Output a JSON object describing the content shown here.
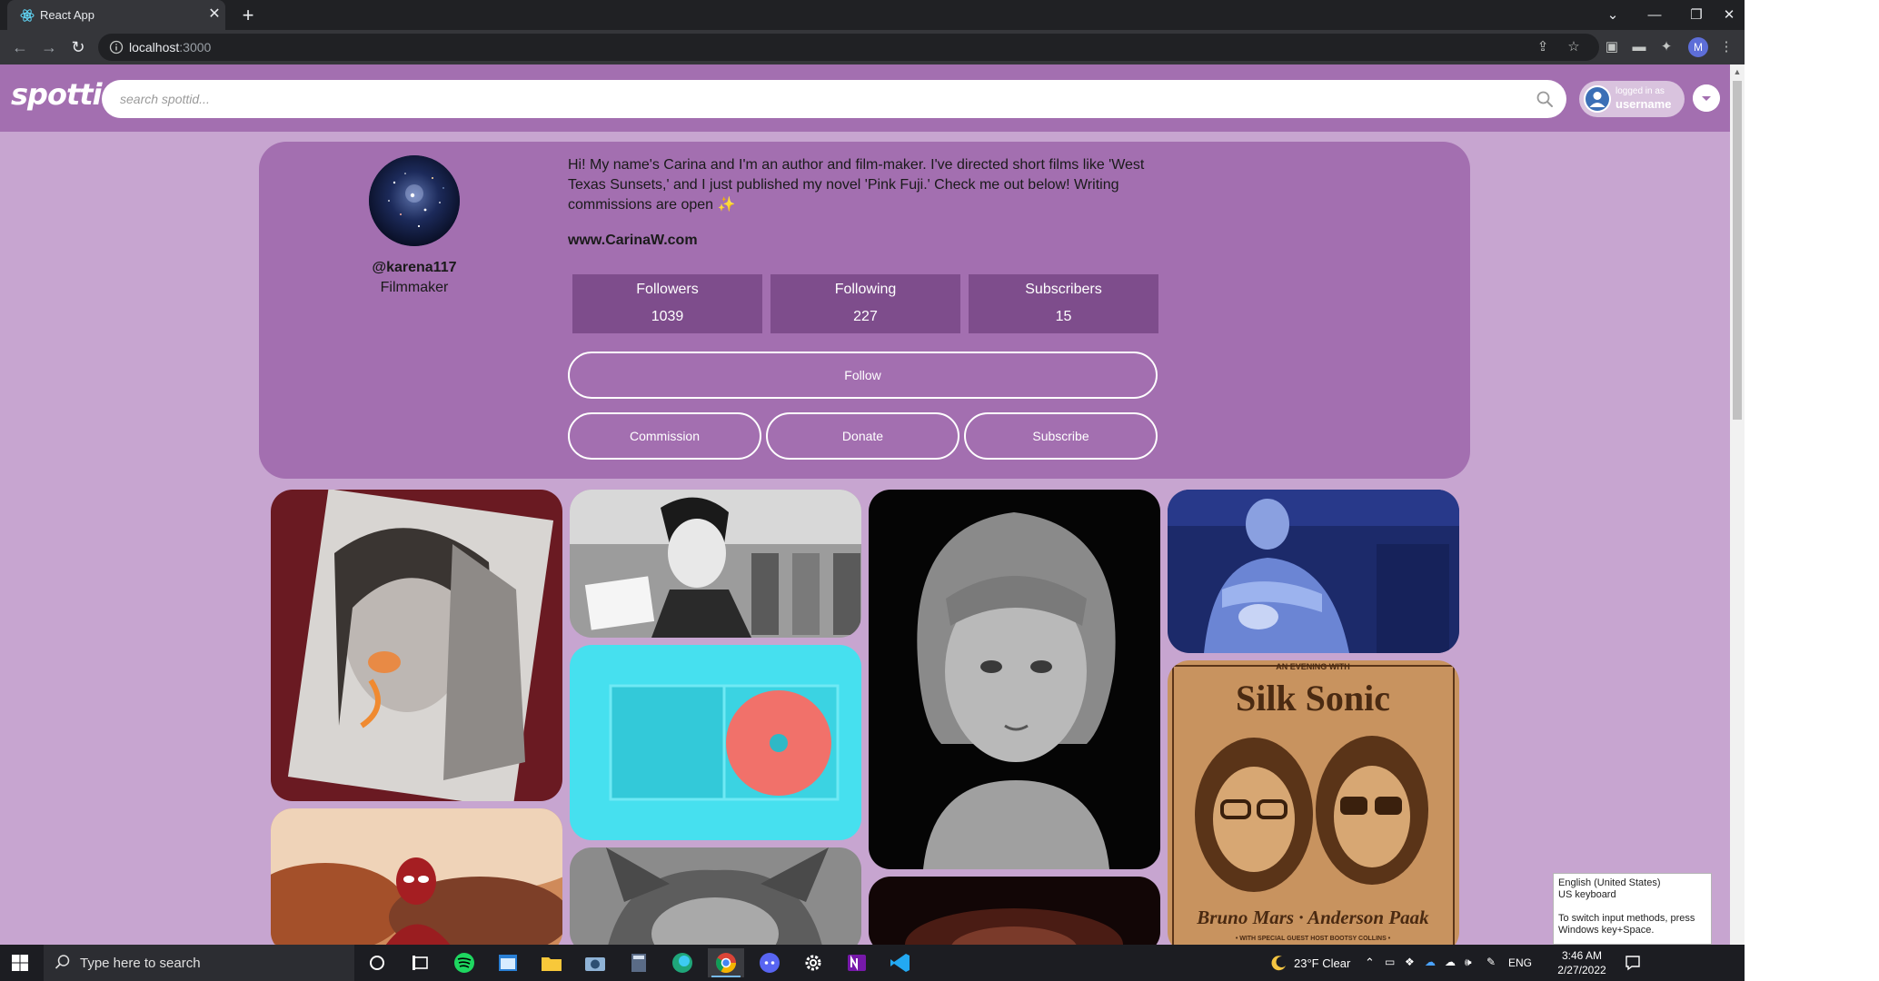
{
  "browser": {
    "tab_title": "React App",
    "url_host": "localhost",
    "url_port": ":3000"
  },
  "app": {
    "logo": "spottid",
    "search_placeholder": "search spottid...",
    "logged_in_label": "logged in as",
    "username": "username"
  },
  "profile": {
    "handle": "@karena117",
    "role": "Filmmaker",
    "bio": "Hi! My name's Carina and I'm an author and film-maker. I've directed short films like 'West Texas Sunsets,' and I just published my novel 'Pink Fuji.' Check me out below! Writing commissions are open ✨",
    "website": "www.CarinaW.com",
    "stats": [
      {
        "label": "Followers",
        "value": "1039"
      },
      {
        "label": "Following",
        "value": "227"
      },
      {
        "label": "Subscribers",
        "value": "15"
      }
    ],
    "buttons": {
      "follow": "Follow",
      "commission": "Commission",
      "donate": "Donate",
      "subscribe": "Subscribe"
    }
  },
  "gallery": {
    "silk_sonic_top": "AN EVENING WITH",
    "silk_sonic_title": "Silk Sonic",
    "silk_sonic_names": "Bruno Mars · Anderson Paak",
    "silk_sonic_bottom": "• WITH SPECIAL GUEST HOST BOOTSY COLLINS •"
  },
  "ime_tooltip": {
    "line1": "English (United States)",
    "line2": "US keyboard",
    "line3": "To switch input methods, press Windows key+Space."
  },
  "taskbar": {
    "search_text": "Type here to search",
    "weather": "23°F  Clear",
    "language": "ENG",
    "time": "3:46 AM",
    "date": "2/27/2022"
  },
  "colors": {
    "header": "#a36fb0",
    "page_bg": "#c7a5d0",
    "stat_box": "#7e4d8c"
  }
}
